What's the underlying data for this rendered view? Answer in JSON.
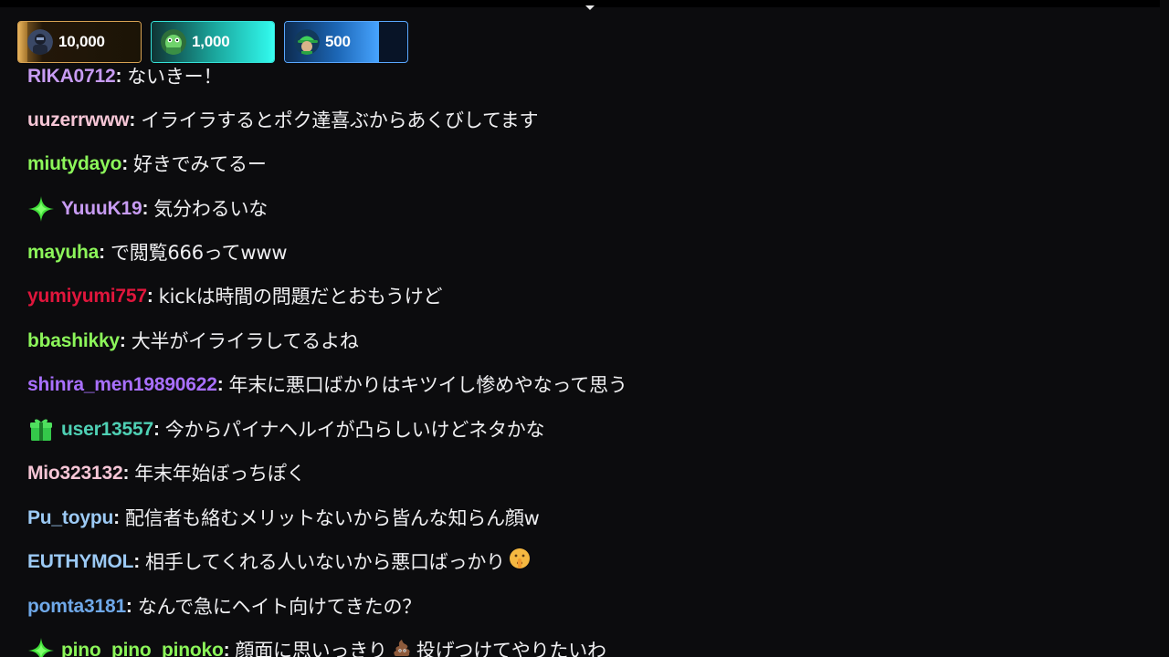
{
  "leaderboard": [
    {
      "value": "10,000",
      "style": "gold",
      "avatar": "dark-user-avatar",
      "fill_percent": 100
    },
    {
      "value": "1,000",
      "style": "teal",
      "avatar": "green-frog-avatar",
      "fill_percent": 100
    },
    {
      "value": "500",
      "style": "blue",
      "avatar": "green-cap-avatar",
      "fill_percent": 77
    }
  ],
  "messages": [
    {
      "user": "RIKA0712",
      "color": "#c79bf2",
      "text": "ないきー！",
      "badge": null,
      "emoji": null
    },
    {
      "user": "uuzerrwww",
      "color": "#f6c6d6",
      "text": "イライラするとポク達喜ぶからあくびしてます",
      "badge": null,
      "emoji": null
    },
    {
      "user": "miutydayo",
      "color": "#8cf65a",
      "text": "好きでみてるー",
      "badge": null,
      "emoji": null
    },
    {
      "user": "YuuuK19",
      "color": "#c79bf2",
      "text": "気分わるいな",
      "badge": "sparkle-badge-icon",
      "emoji": null
    },
    {
      "user": "mayuha",
      "color": "#8cf65a",
      "text": "で閲覧666ってwww",
      "badge": null,
      "emoji": null
    },
    {
      "user": "yumiyumi757",
      "color": "#e0163c",
      "text": "kickは時間の問題だとおもうけど",
      "badge": null,
      "emoji": null
    },
    {
      "user": "bbashikky",
      "color": "#8cf65a",
      "text": "大半がイライラしてるよね",
      "badge": null,
      "emoji": null
    },
    {
      "user": "shinra_men19890622",
      "color": "#a970ff",
      "text": "年末に悪口ばかりはキツイし惨めやなって思う",
      "badge": null,
      "emoji": null
    },
    {
      "user": "user13557",
      "color": "#4fd0b4",
      "text": "今からパイナヘルイが凸らしいけどネタかな",
      "badge": "gift-badge-icon",
      "emoji": null
    },
    {
      "user": "Mio323132",
      "color": "#f6c6d6",
      "text": "年末年始ぼっちぽく",
      "badge": null,
      "emoji": null
    },
    {
      "user": "Pu_toypu",
      "color": "#9ccaf5",
      "text": "配信者も絡むメリットないから皆んな知らん顔w",
      "badge": null,
      "emoji": null
    },
    {
      "user": "EUTHYMOL",
      "color": "#9ccaf5",
      "text": "相手してくれる人いないから悪口ばっかり",
      "badge": null,
      "emoji": "shushing-face-emoji"
    },
    {
      "user": "pomta3181",
      "color": "#6fa8e8",
      "text": "なんで急にヘイト向けてきたの？",
      "badge": null,
      "emoji": null
    },
    {
      "user": "pino_pino_pinoko",
      "color": "#8cf65a",
      "text": "顔面に思いっきり",
      "badge": "sparkle-badge-icon",
      "emoji": "poop-emoji",
      "text_after": "投げつけてやりたいわ"
    }
  ]
}
